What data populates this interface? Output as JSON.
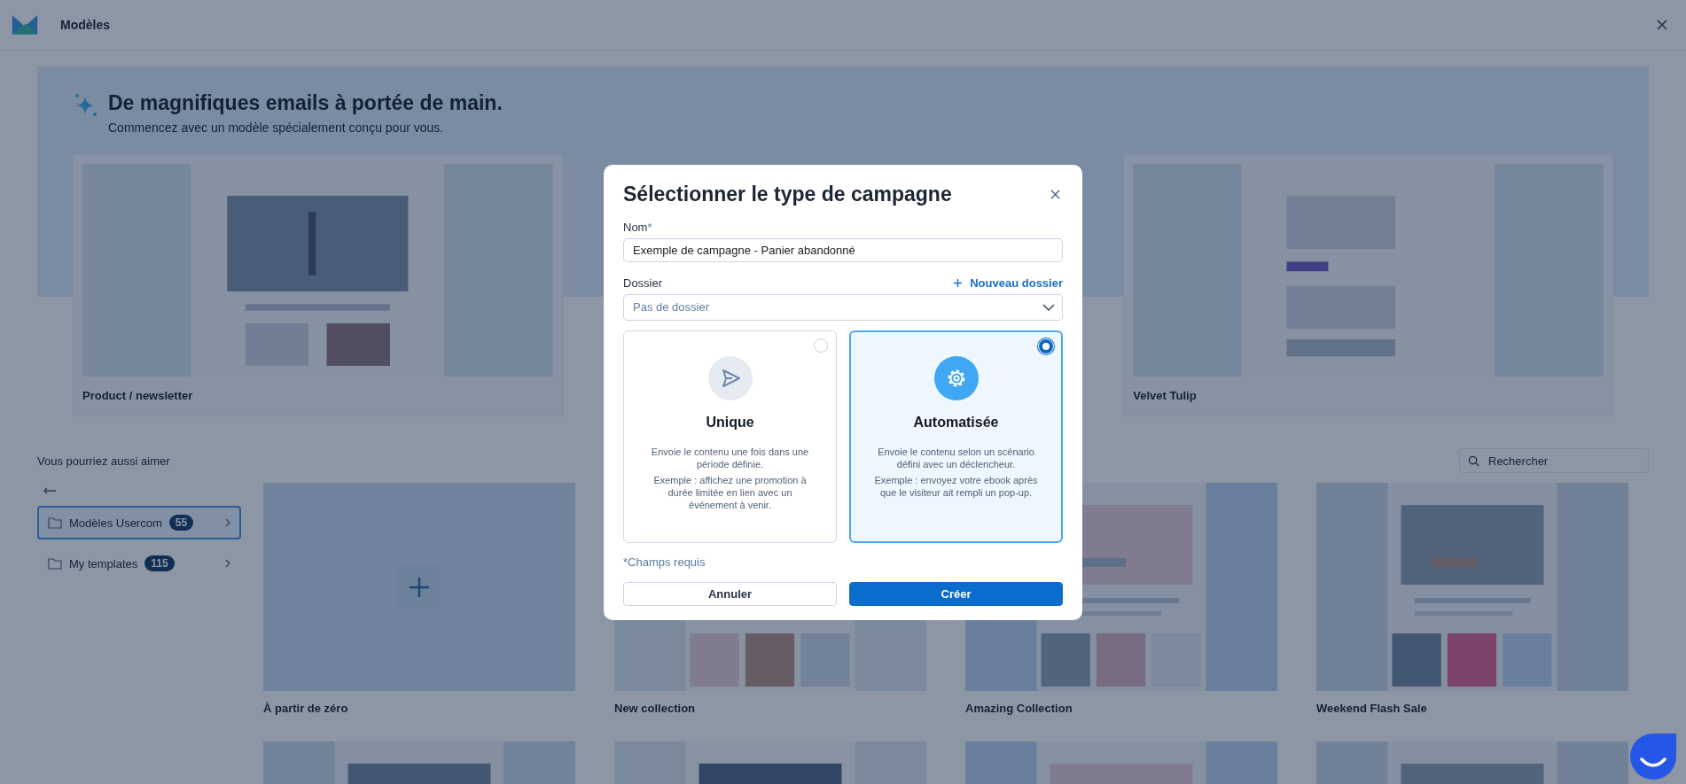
{
  "header": {
    "title": "Modèles"
  },
  "hero": {
    "title": "De magnifiques emails à portée de main.",
    "subtitle": "Commencez avec un modèle spécialement conçu pour vous."
  },
  "featured": [
    {
      "title": "Product / newsletter"
    },
    {
      "title": "Velvet Tulip"
    }
  ],
  "section_title": "Vous pourriez aussi aimer",
  "search": {
    "placeholder": "Rechercher"
  },
  "folders": [
    {
      "label": "Modèles Usercom",
      "count": "55",
      "selected": true
    },
    {
      "label": "My templates",
      "count": "115",
      "selected": false
    }
  ],
  "templates": [
    {
      "title": "À partir de zéro",
      "kind": "blank"
    },
    {
      "title": "New collection",
      "kind": "picture"
    },
    {
      "title": "Amazing Collection",
      "kind": "picture"
    },
    {
      "title": "Weekend Flash Sale",
      "kind": "picture"
    },
    {
      "kind": "picture"
    },
    {
      "kind": "picture"
    },
    {
      "kind": "picture"
    },
    {
      "kind": "picture"
    }
  ],
  "modal": {
    "title": "Sélectionner le type de campagne",
    "name_field": {
      "label": "Nom",
      "required_mark": "*",
      "value": "Exemple de campagne - Panier abandonné"
    },
    "folder_field": {
      "label": "Dossier",
      "value": "Pas de dossier"
    },
    "new_folder_link": "Nouveau dossier",
    "options": [
      {
        "kind": "single",
        "title": "Unique",
        "description": "Envoie le contenu une fois dans une période définie.",
        "example": "Exemple : affichez une promotion à durée limitée en lien avec un événement à venir.",
        "selected": false
      },
      {
        "kind": "automated",
        "title": "Automatisée",
        "description": "Envoie le contenu selon un scénario défini avec un déclencheur.",
        "example": "Exemple : envoyez votre ebook après que le visiteur ait rempli un pop-up.",
        "selected": true
      }
    ],
    "required_note": "*Champs requis",
    "buttons": [
      {
        "label": "Annuler",
        "kind": "secondary"
      },
      {
        "label": "Créer",
        "kind": "primary"
      }
    ]
  }
}
